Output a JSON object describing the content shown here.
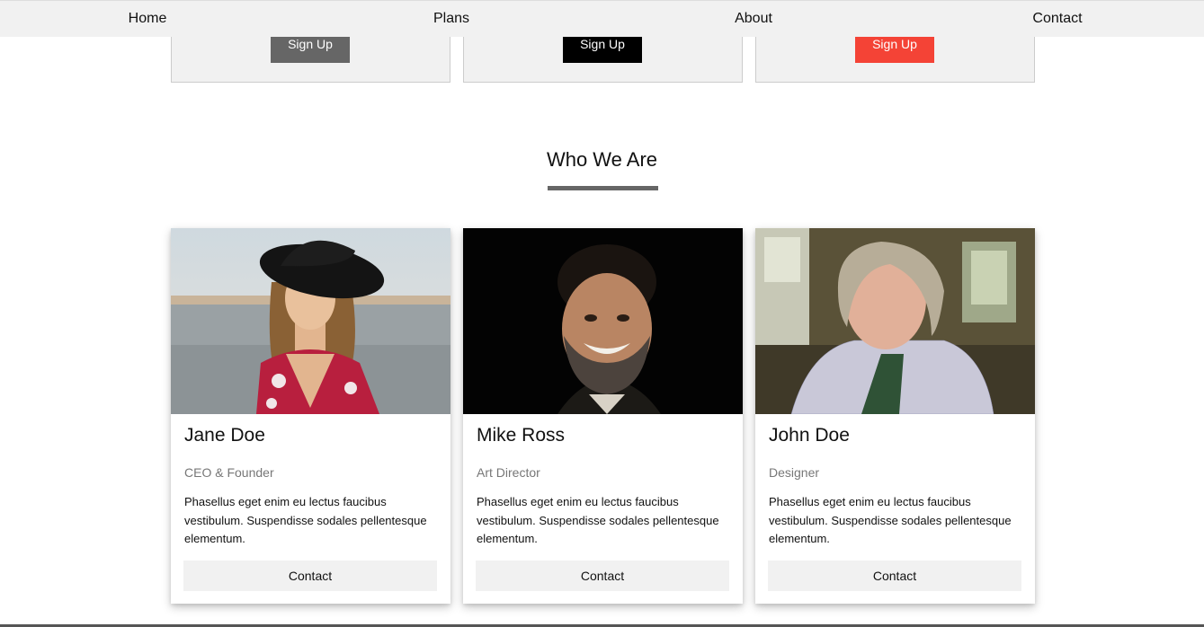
{
  "nav": {
    "items": [
      "Home",
      "Plans",
      "About",
      "Contact"
    ]
  },
  "plans": [
    {
      "button_label": "Sign Up",
      "button_color": "#666666"
    },
    {
      "button_label": "Sign Up",
      "button_color": "#000000"
    },
    {
      "button_label": "Sign Up",
      "button_color": "#f44336"
    }
  ],
  "about": {
    "title": "Who We Are"
  },
  "team": [
    {
      "name": "Jane Doe",
      "role": "CEO & Founder",
      "bio": "Phasellus eget enim eu lectus faucibus vestibulum. Suspendisse sodales pellentesque elementum.",
      "contact_label": "Contact"
    },
    {
      "name": "Mike Ross",
      "role": "Art Director",
      "bio": "Phasellus eget enim eu lectus faucibus vestibulum. Suspendisse sodales pellentesque elementum.",
      "contact_label": "Contact"
    },
    {
      "name": "John Doe",
      "role": "Designer",
      "bio": "Phasellus eget enim eu lectus faucibus vestibulum. Suspendisse sodales pellentesque elementum.",
      "contact_label": "Contact"
    }
  ]
}
